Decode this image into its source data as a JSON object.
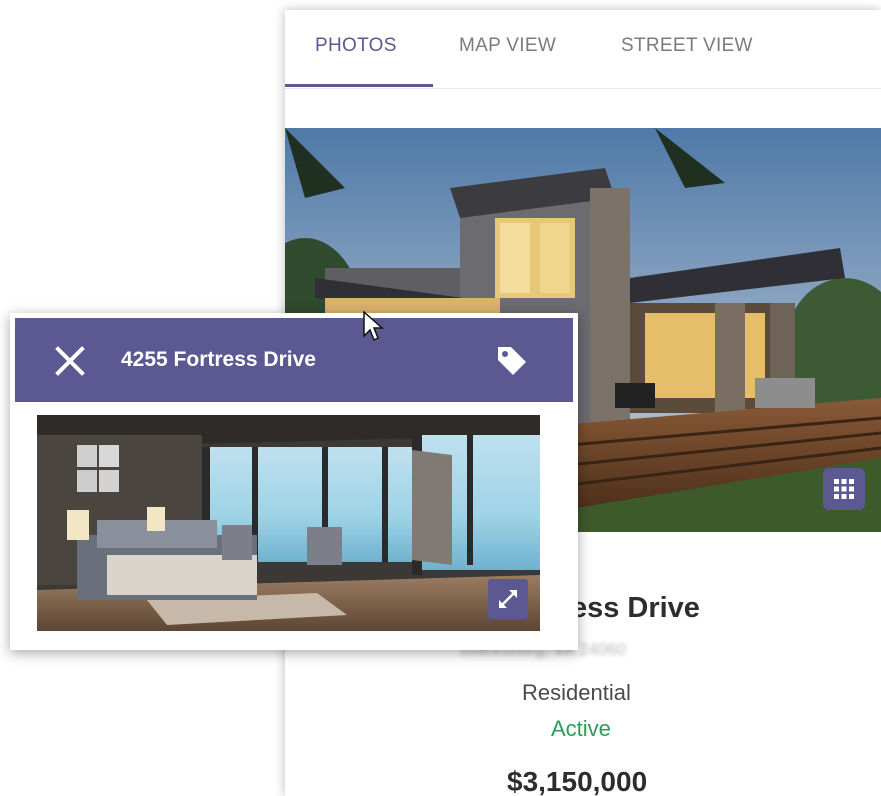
{
  "tabs": [
    {
      "label": "PHOTOS",
      "active": true
    },
    {
      "label": "MAP VIEW",
      "active": false
    },
    {
      "label": "STREET VIEW",
      "active": false
    }
  ],
  "listing": {
    "street_partial": "tress Drive",
    "city_blurred": "Blacksburg, VA 24060",
    "property_type": "Residential",
    "status": "Active",
    "price": "$3,150,000"
  },
  "popup": {
    "title": "4255 Fortress Drive"
  },
  "icons": {
    "close": "close-icon",
    "tag": "tag-icon",
    "gallery": "grid-icon",
    "expand": "expand-icon"
  },
  "colors": {
    "accent": "#5c5891",
    "status_active": "#2e9b57"
  }
}
